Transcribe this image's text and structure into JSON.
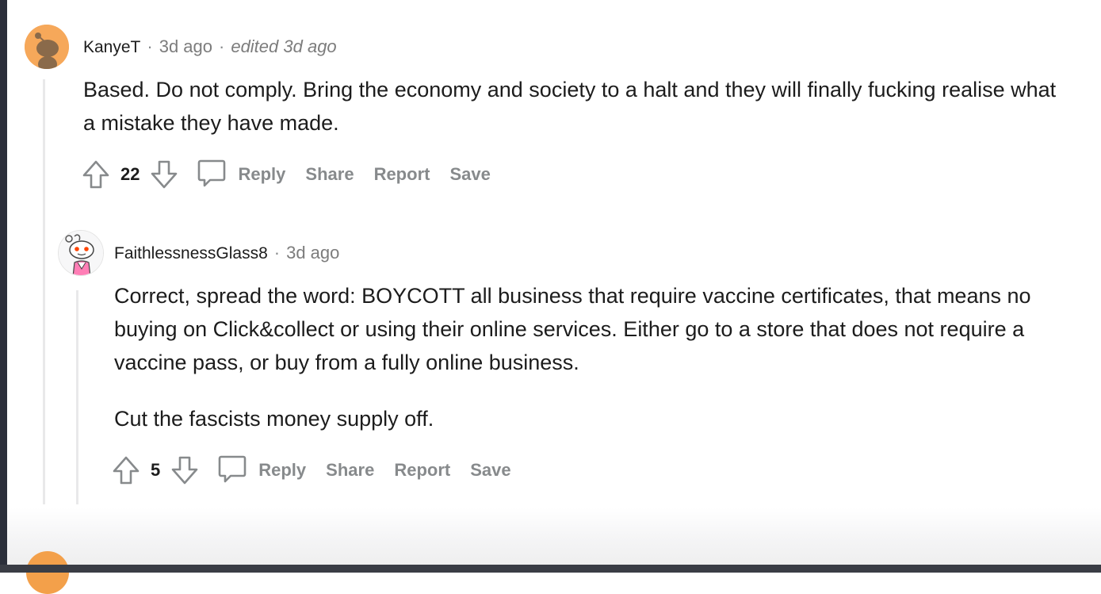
{
  "comments": [
    {
      "author": "KanyeT",
      "time": "3d ago",
      "edited": "edited 3d ago",
      "paragraphs": [
        "Based. Do not comply. Bring the economy and society to a halt and they will finally fucking realise what a mistake they have made."
      ],
      "score": "22",
      "actions": {
        "reply": "Reply",
        "share": "Share",
        "report": "Report",
        "save": "Save"
      },
      "avatar_color": "#f6a85a"
    },
    {
      "author": "FaithlessnessGlass8",
      "time": "3d ago",
      "paragraphs": [
        "Correct, spread the word: BOYCOTT all business that require vaccine certificates, that means no buying on Click&collect or using their online services. Either go to a store that does not require a vaccine pass, or buy from a fully online business.",
        "Cut the fascists money supply off."
      ],
      "score": "5",
      "actions": {
        "reply": "Reply",
        "share": "Share",
        "report": "Report",
        "save": "Save"
      },
      "avatar_color": "#ffffff"
    }
  ],
  "colors": {
    "text": "#1c1c1c",
    "meta": "#7c7c7c",
    "action": "#878a8c",
    "thread_line": "#e9e9ea"
  },
  "icons": [
    "upvote-icon",
    "downvote-icon",
    "comment-icon",
    "snoo-avatar-icon"
  ]
}
